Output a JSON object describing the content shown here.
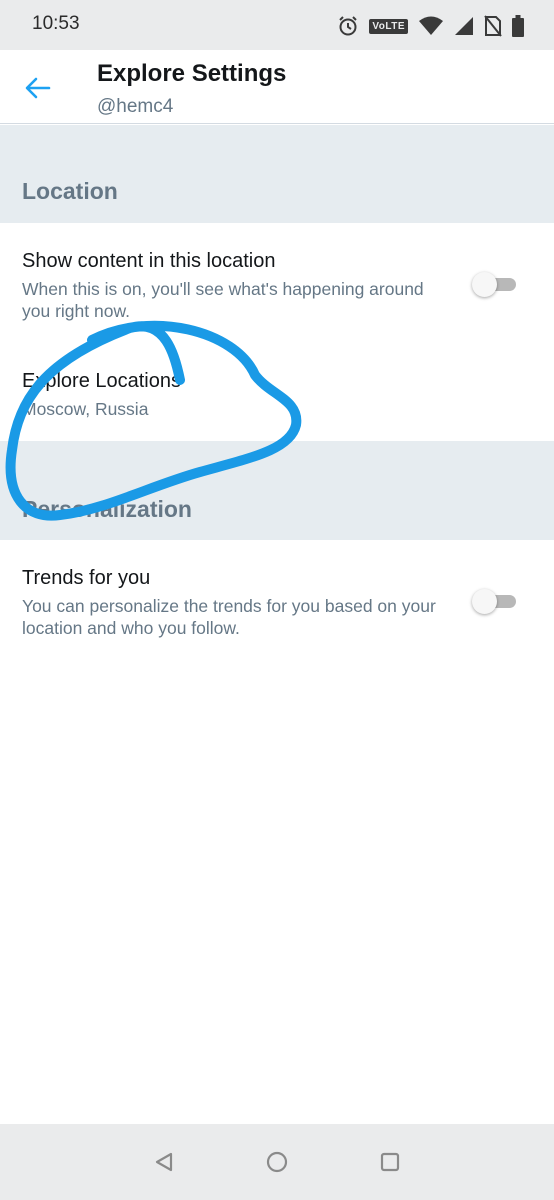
{
  "status_bar": {
    "time": "10:53",
    "volte": "VoLTE",
    "icons": [
      "alarm-icon",
      "volte-icon",
      "wifi-icon",
      "signal-icon",
      "no-sim-icon",
      "battery-icon"
    ]
  },
  "header": {
    "title": "Explore Settings",
    "subtitle": "@hemc4",
    "back_icon": "back-arrow-icon",
    "accent_color": "#1da1f2"
  },
  "sections": {
    "location": {
      "title": "Location",
      "show_content": {
        "title": "Show content in this location",
        "description": "When this is on, you'll see what's happening around you right now.",
        "toggle_on": false
      },
      "explore_locations": {
        "title": "Explore Locations",
        "value": "Moscow, Russia"
      }
    },
    "personalization": {
      "title": "Personalization",
      "trends": {
        "title": "Trends for you",
        "description": "You can personalize the trends for you based on your location and who you follow.",
        "toggle_on": false
      }
    }
  },
  "annotation": {
    "color": "#1a9ae6"
  },
  "nav_bar": {
    "icons": [
      "nav-back-icon",
      "nav-home-icon",
      "nav-recents-icon"
    ]
  }
}
